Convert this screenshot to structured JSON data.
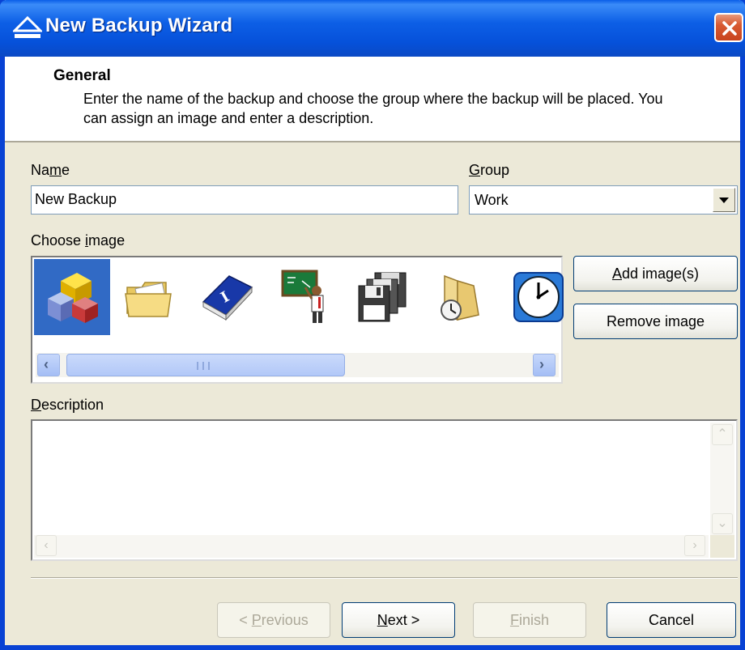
{
  "window": {
    "title": "New Backup Wizard"
  },
  "header": {
    "title": "General",
    "description": "Enter the name of the backup and choose the group where the backup will be placed. You can assign an image and enter a description."
  },
  "form": {
    "name_label_pre": "Na",
    "name_label_u": "m",
    "name_label_post": "e",
    "name_value": "New Backup",
    "group_label_u": "G",
    "group_label_post": "roup",
    "group_value": "Work",
    "choose_image_label_pre": "Choose ",
    "choose_image_label_u": "i",
    "choose_image_label_post": "mage",
    "description_label_u": "D",
    "description_label_post": "escription",
    "description_value": ""
  },
  "images": [
    {
      "icon": "blocks-icon",
      "selected": true
    },
    {
      "icon": "folder-icon",
      "selected": false
    },
    {
      "icon": "book-icon",
      "selected": false
    },
    {
      "icon": "teacher-icon",
      "selected": false
    },
    {
      "icon": "floppy-disks-icon",
      "selected": false
    },
    {
      "icon": "clock-folder-icon",
      "selected": false
    },
    {
      "icon": "clock-icon",
      "selected": false
    }
  ],
  "buttons": {
    "add_image_u": "A",
    "add_image_rest": "dd image(s)",
    "remove_image": "Remove image",
    "previous_pre": "< ",
    "previous_u": "P",
    "previous_post": "revious",
    "next_u": "N",
    "next_post": "ext >",
    "finish_u": "F",
    "finish_post": "inish",
    "cancel": "Cancel"
  },
  "colors": {
    "titlebar": "#0a5ee8",
    "selection": "#316ac5",
    "dialog_bg": "#ece9d8"
  }
}
